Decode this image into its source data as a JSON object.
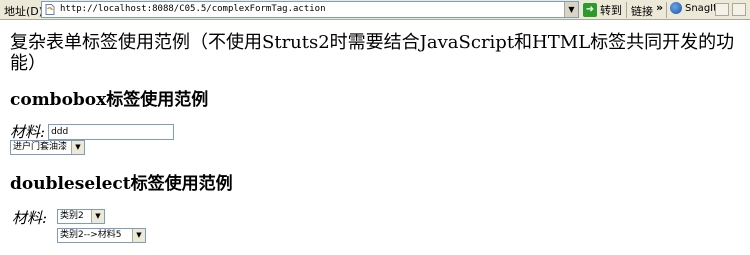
{
  "browser": {
    "address_label": "地址(D)",
    "url": "http://localhost:8088/C05.5/complexFormTag.action",
    "go_label": "转到",
    "links_label": "链接",
    "toolbar_chevron": "»",
    "snagit_label": "SnagIt"
  },
  "page": {
    "title": "复杂表单标签使用范例（不使用Struts2时需要结合JavaScript和HTML标签共同开发的功能）",
    "combobox": {
      "heading": "combobox标签使用范例",
      "label": "材料:",
      "input_value": "ddd",
      "select_value": "进户门套油漆"
    },
    "doubleselect": {
      "heading": "doubleselect标签使用范例",
      "label": "材料:",
      "first_select_value": "类别2",
      "second_select_value": "类别2-->材料5"
    }
  },
  "icons": {
    "page": "page-icon",
    "dropdown": "chevron-down-icon",
    "go": "go-arrow-icon",
    "snagit": "snagit-icon"
  }
}
